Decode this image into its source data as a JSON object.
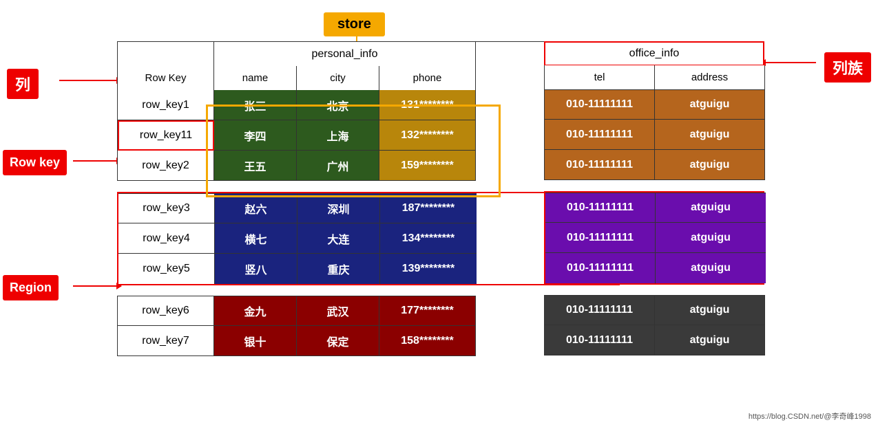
{
  "labels": {
    "lie": "列",
    "rowkey": "Row key",
    "region": "Region",
    "liezu": "列族",
    "store": "store"
  },
  "headers": {
    "rowkey": "Row Key",
    "personal_info": "personal_info",
    "name": "name",
    "city": "city",
    "phone": "phone",
    "office_info": "office_info",
    "tel": "tel",
    "address": "address"
  },
  "group1": {
    "rows": [
      {
        "rowkey": "row_key1",
        "name": "张三",
        "city": "北京",
        "phone": "131********",
        "tel": "010-11111111",
        "address": "atguigu"
      },
      {
        "rowkey": "row_key11",
        "name": "李四",
        "city": "上海",
        "phone": "132********",
        "tel": "010-11111111",
        "address": "atguigu"
      },
      {
        "rowkey": "row_key2",
        "name": "王五",
        "city": "广州",
        "phone": "159********",
        "tel": "010-11111111",
        "address": "atguigu"
      }
    ]
  },
  "group2": {
    "rows": [
      {
        "rowkey": "row_key3",
        "name": "赵六",
        "city": "深圳",
        "phone": "187********",
        "tel": "010-11111111",
        "address": "atguigu"
      },
      {
        "rowkey": "row_key4",
        "name": "横七",
        "city": "大连",
        "phone": "134********",
        "tel": "010-11111111",
        "address": "atguigu"
      },
      {
        "rowkey": "row_key5",
        "name": "竖八",
        "city": "重庆",
        "phone": "139********",
        "tel": "010-11111111",
        "address": "atguigu"
      }
    ]
  },
  "group3": {
    "rows": [
      {
        "rowkey": "row_key6",
        "name": "金九",
        "city": "武汉",
        "phone": "177********",
        "tel": "010-11111111",
        "address": "atguigu"
      },
      {
        "rowkey": "row_key7",
        "name": "银十",
        "city": "保定",
        "phone": "158********",
        "tel": "010-11111111",
        "address": "atguigu"
      }
    ]
  },
  "watermark": "https://blog.CSDN.net/@李奇峰1998"
}
